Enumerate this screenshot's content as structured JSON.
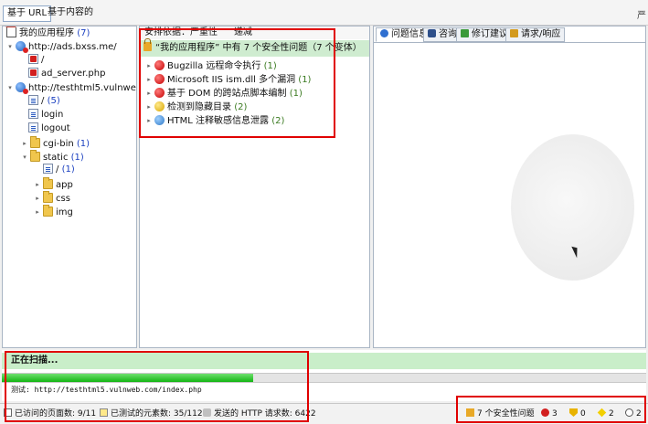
{
  "top_tabs": [
    {
      "label": "基于 URL",
      "active": true
    },
    {
      "label": "基于内容的",
      "active": false
    }
  ],
  "corner_text": "严",
  "tree": [
    {
      "label": "我的应用程序",
      "count": "(7)",
      "icon": "home-icon"
    },
    {
      "label": "http://ads.bxss.me/",
      "count": "",
      "icon": "globe-icon"
    },
    {
      "label": "/",
      "count": "",
      "icon": "page-error-icon"
    },
    {
      "label": "ad_server.php",
      "count": "",
      "icon": "page-error-icon"
    },
    {
      "label": "http://testhtml5.vulnweb.com/",
      "count": "(",
      "icon": "globe-icon"
    },
    {
      "label": "/",
      "count": "(5)",
      "icon": "page-icon"
    },
    {
      "label": "login",
      "count": "",
      "icon": "page-icon"
    },
    {
      "label": "logout",
      "count": "",
      "icon": "page-icon"
    },
    {
      "label": "cgi-bin",
      "count": "(1)",
      "icon": "folder-icon"
    },
    {
      "label": "static",
      "count": "(1)",
      "icon": "folder-icon"
    },
    {
      "label": "/",
      "count": "(1)",
      "icon": "page-icon"
    },
    {
      "label": "app",
      "count": "",
      "icon": "folder-icon"
    },
    {
      "label": "css",
      "count": "",
      "icon": "folder-icon"
    },
    {
      "label": "img",
      "count": "",
      "icon": "folder-icon"
    }
  ],
  "middle": {
    "sort_label": "安排依据：严重性",
    "hide_label": "递减",
    "summary": "“我的应用程序” 中有 7 个安全性问题（7 个变体）",
    "issues": [
      {
        "label": "Bugzilla 远程命令执行",
        "count": "(1)",
        "severity": "high"
      },
      {
        "label": "Microsoft IIS ism.dll 多个漏洞",
        "count": "(1)",
        "severity": "high"
      },
      {
        "label": "基于 DOM 的跨站点脚本编制",
        "count": "(1)",
        "severity": "high"
      },
      {
        "label": "检测到隐藏目录",
        "count": "(2)",
        "severity": "low"
      },
      {
        "label": "HTML 注释敏感信息泄露",
        "count": "(2)",
        "severity": "info"
      }
    ]
  },
  "detail_tabs": [
    {
      "label": "问题信息",
      "active": true,
      "icon": "info-icon"
    },
    {
      "label": "咨询",
      "active": false,
      "icon": "shield-icon"
    },
    {
      "label": "修订建议",
      "active": false,
      "icon": "check-icon"
    },
    {
      "label": "请求/响应",
      "active": false,
      "icon": "key-icon"
    }
  ],
  "scan": {
    "title": "正在扫描...",
    "progress_fraction": 0.39,
    "url_text": "测试: http://testhtml5.vulnweb.com/index.php"
  },
  "status": {
    "visited_pages": "已访问的页面数: 9/11",
    "tested_elements": "已测试的元素数: 35/112",
    "http_requests": "发送的 HTTP 请求数: 6422",
    "security_issues": "7 个安全性问题",
    "high_count": "3",
    "medium_count": "0",
    "low_count": "2",
    "info_count": "2"
  },
  "colors": {
    "annotation_red": "#e00000",
    "progress_green": "#13b513",
    "summary_green": "#cfecd0",
    "count_blue": "#1a3fc0"
  }
}
